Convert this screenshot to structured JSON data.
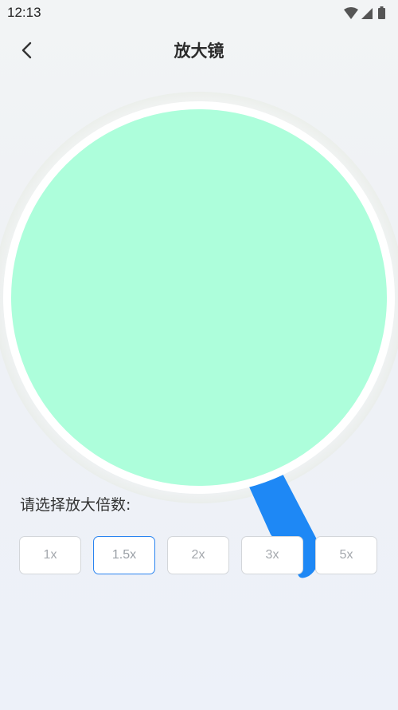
{
  "status_bar": {
    "time": "12:13",
    "icons": [
      "wifi-icon",
      "signal-icon",
      "battery-icon"
    ]
  },
  "app_bar": {
    "title": "放大镜",
    "back_icon": "chevron-left-icon"
  },
  "magnifier": {
    "lens_color": "#adfedb",
    "rim_color": "#ffffff",
    "handle_color": "#1e88f5"
  },
  "zoom": {
    "prompt": "请选择放大倍数:",
    "options": [
      "1x",
      "1.5x",
      "2x",
      "3x",
      "5x"
    ],
    "selected": "1.5x"
  },
  "colors": {
    "accent": "#2a84f0",
    "title_text": "#2b2b2b",
    "option_text": "#a4a8ad"
  }
}
